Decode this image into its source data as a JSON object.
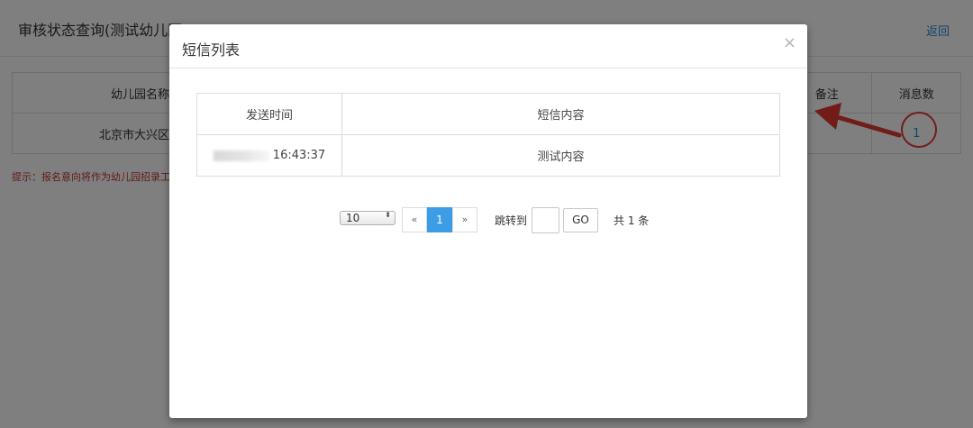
{
  "background": {
    "title": "审核状态查询(测试幼儿园)",
    "back_link": "返回",
    "table": {
      "headers": [
        "幼儿园名称",
        "",
        "备注",
        "消息数"
      ],
      "row": [
        "北京市大兴区",
        "",
        "",
        "1"
      ]
    },
    "hint": "提示：报名意向将作为幼儿园招录工作"
  },
  "modal": {
    "title": "短信列表",
    "close_icon": "×",
    "table": {
      "headers": [
        "发送时间",
        "短信内容"
      ],
      "rows": [
        {
          "time": "16:43:37",
          "content": "测试内容"
        }
      ]
    },
    "pager": {
      "page_size": "10",
      "page_size_arrows": "⬍",
      "prev": "«",
      "current": "1",
      "next": "»",
      "jump_label": "跳转到",
      "go": "GO",
      "total": "共 1 条"
    }
  },
  "colors": {
    "accent": "#3c9de6",
    "link": "#2a8bd6",
    "annotation": "#e53935"
  }
}
